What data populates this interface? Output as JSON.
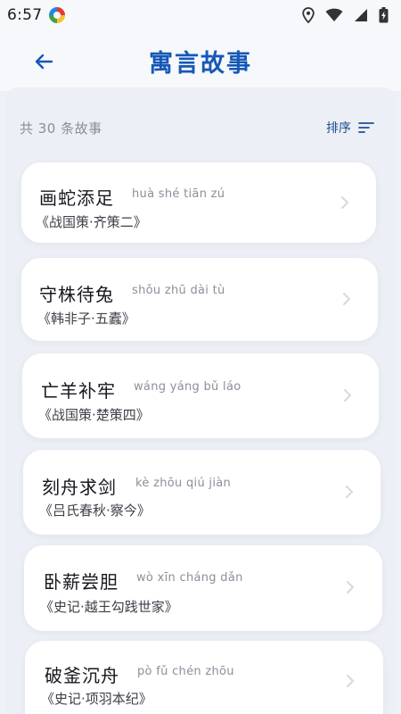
{
  "status_bar": {
    "time": "6:57"
  },
  "app_bar": {
    "title": "寓言故事"
  },
  "list_header": {
    "count_text": "共 30 条故事",
    "sort_label": "排序"
  },
  "stories": [
    {
      "title": "画蛇添足",
      "pinyin": "huà shé tiān zú",
      "source": "《战国策·齐策二》"
    },
    {
      "title": "守株待兔",
      "pinyin": "shǒu zhū dài tù",
      "source": "《韩非子·五蠹》"
    },
    {
      "title": "亡羊补牢",
      "pinyin": "wáng yáng bǔ láo",
      "source": "《战国策·楚策四》"
    },
    {
      "title": "刻舟求剑",
      "pinyin": "kè zhōu qiú jiàn",
      "source": "《吕氏春秋·察今》"
    },
    {
      "title": "卧薪尝胆",
      "pinyin": "wò xīn cháng dǎn",
      "source": "《史记·越王勾践世家》"
    },
    {
      "title": "破釜沉舟",
      "pinyin": "pò fǔ chén zhōu",
      "source": "《史记·项羽本纪》"
    }
  ]
}
